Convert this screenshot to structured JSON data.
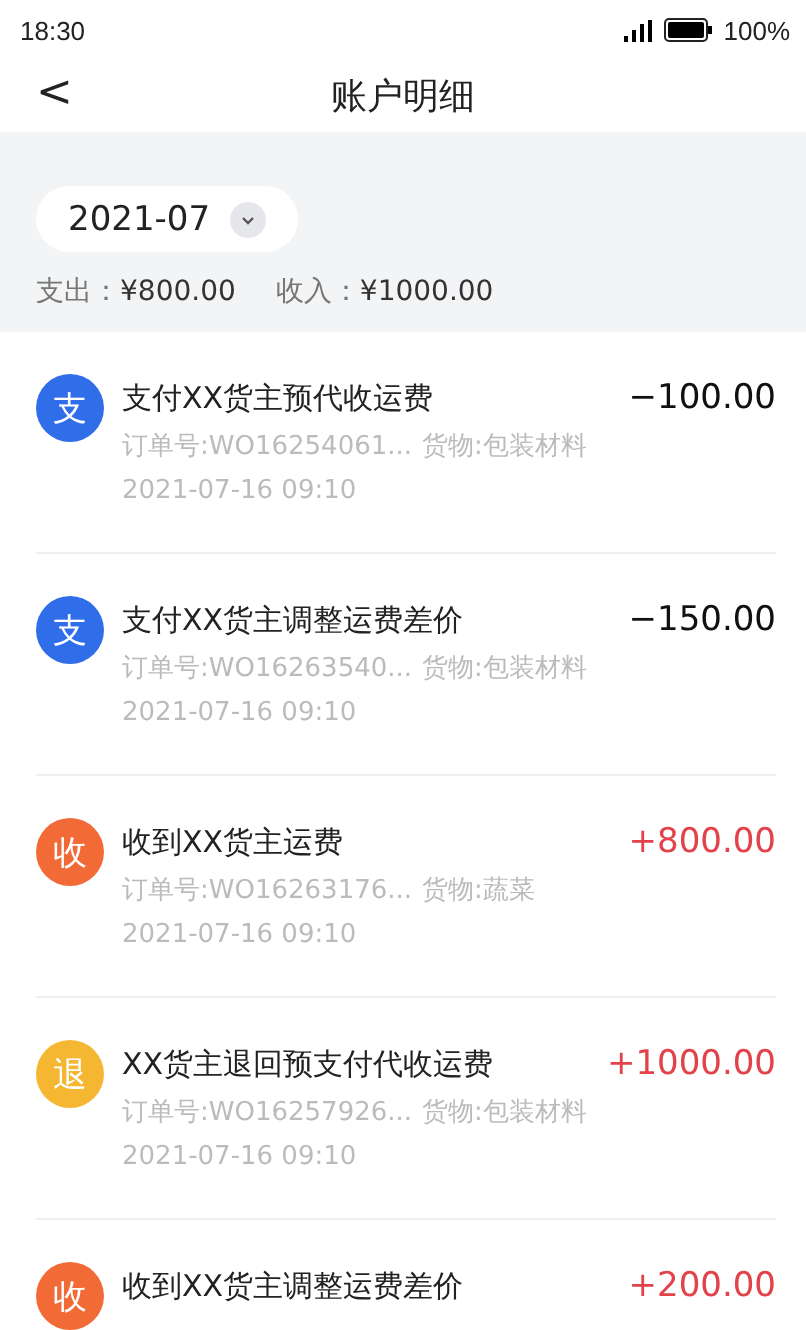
{
  "status_bar": {
    "time": "18:30",
    "battery": "100%"
  },
  "header": {
    "back": "<",
    "title": "账户明细"
  },
  "summary": {
    "month": "2021-07",
    "expense_label": "支出：",
    "expense": "¥800.00",
    "income_label": "收入：",
    "income": "¥1000.00"
  },
  "records": [
    {
      "kind": "expense",
      "badge": "支",
      "color": "#2f6ee8",
      "title": "支付XX货主预代收运费",
      "amount": "−100.00",
      "order": "订单号:WO16254061...",
      "goods": "货物:包装材料",
      "time": "2021-07-16 09:10"
    },
    {
      "kind": "expense",
      "badge": "支",
      "color": "#2f6ee8",
      "title": "支付XX货主调整运费差价",
      "amount": "−150.00",
      "order": "订单号:WO16263540...",
      "goods": "货物:包装材料",
      "time": "2021-07-16 09:10"
    },
    {
      "kind": "income",
      "badge": "收",
      "color": "#f26a35",
      "title": "收到XX货主运费",
      "amount": "+800.00",
      "order": "订单号:WO16263176...",
      "goods": "货物:蔬菜",
      "time": "2021-07-16 09:10"
    },
    {
      "kind": "income",
      "badge": "退",
      "color": "#f5b731",
      "title": "XX货主退回预支付代收运费",
      "amount": "+1000.00",
      "order": "订单号:WO16257926...",
      "goods": "货物:包装材料",
      "time": "2021-07-16 09:10"
    },
    {
      "kind": "income",
      "badge": "收",
      "color": "#f26a35",
      "title": "收到XX货主调整运费差价",
      "amount": "+200.00"
    }
  ]
}
